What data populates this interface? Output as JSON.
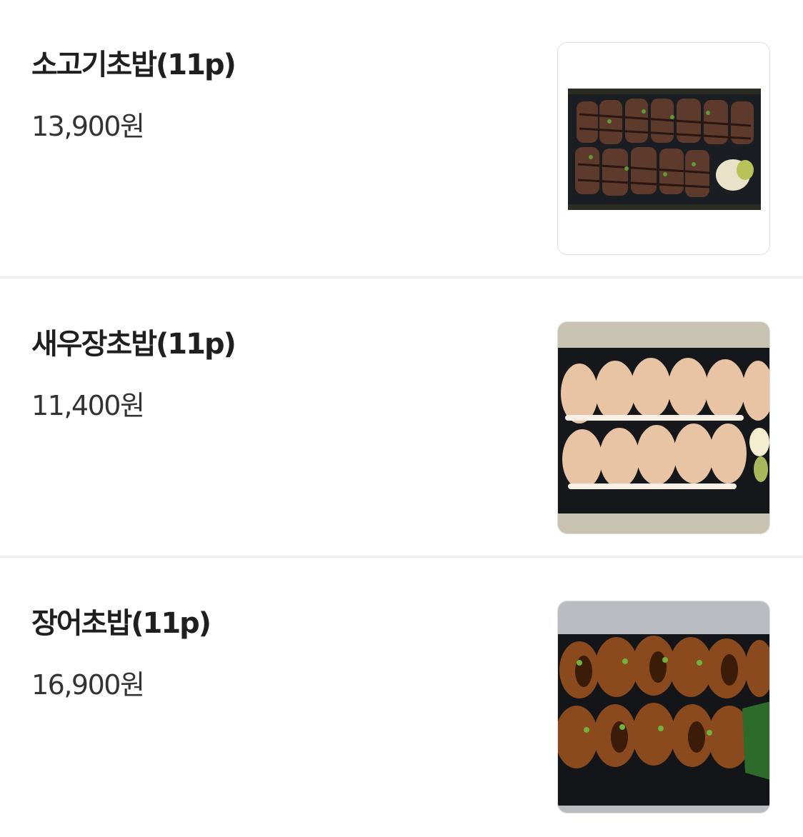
{
  "menu_items": [
    {
      "name": "소고기초밥(11p)",
      "price": "13,900원",
      "image_icon": "beef-sushi-photo"
    },
    {
      "name": "새우장초밥(11p)",
      "price": "11,400원",
      "image_icon": "shrimp-sushi-photo"
    },
    {
      "name": "장어초밥(11p)",
      "price": "16,900원",
      "image_icon": "eel-sushi-photo"
    }
  ]
}
